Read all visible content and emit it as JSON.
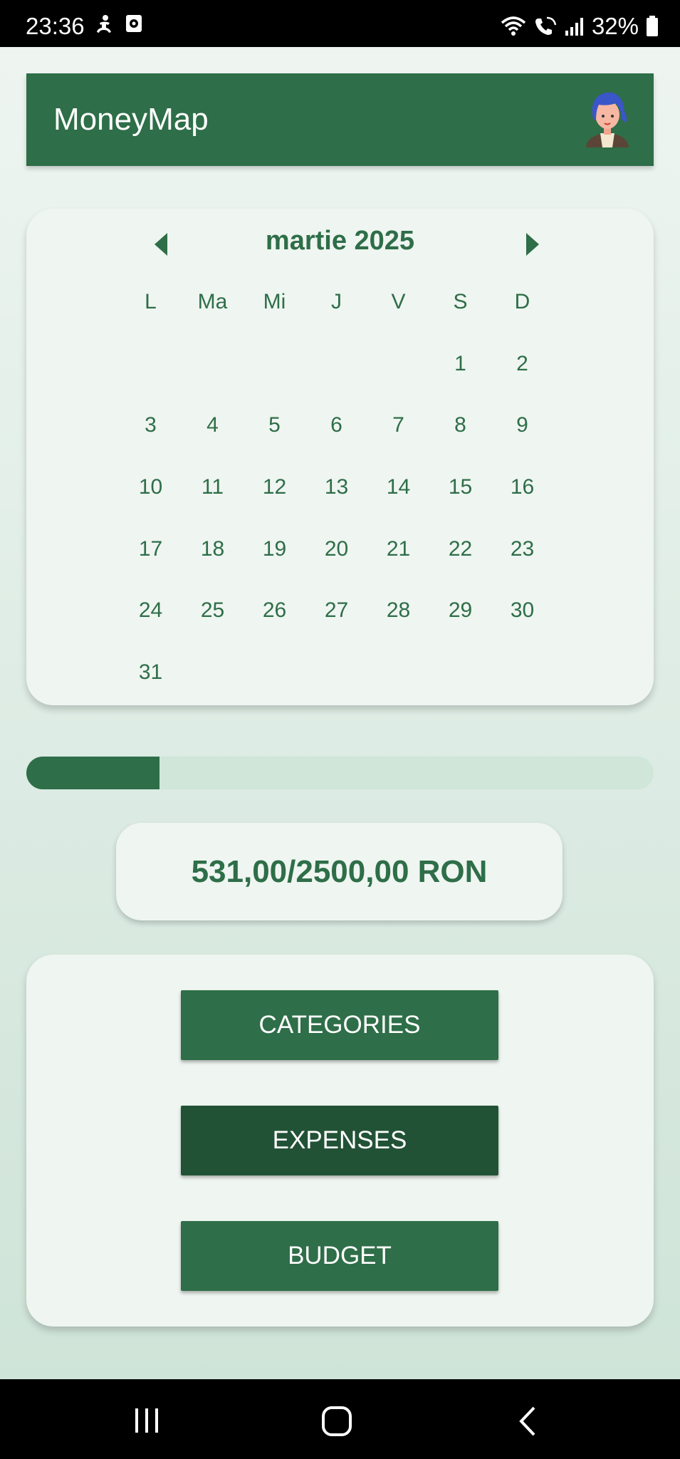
{
  "status_bar": {
    "time": "23:36",
    "battery_percent": "32%",
    "left_icons": [
      "accessibility-icon",
      "screenshot-icon"
    ],
    "right_icons": [
      "wifi-icon",
      "wifi-calling-icon",
      "signal-icon",
      "battery-icon"
    ]
  },
  "app_bar": {
    "title": "MoneyMap",
    "avatar_icon": "user-avatar"
  },
  "calendar": {
    "month_label": "martie 2025",
    "weekdays": [
      "L",
      "Ma",
      "Mi",
      "J",
      "V",
      "S",
      "D"
    ],
    "leading_blanks": 5,
    "days": [
      "1",
      "2",
      "3",
      "4",
      "5",
      "6",
      "7",
      "8",
      "9",
      "10",
      "11",
      "12",
      "13",
      "14",
      "15",
      "16",
      "17",
      "18",
      "19",
      "20",
      "21",
      "22",
      "23",
      "24",
      "25",
      "26",
      "27",
      "28",
      "29",
      "30",
      "31"
    ]
  },
  "budget": {
    "progress_fraction": 0.2124,
    "amount_text": "531,00/2500,00 RON"
  },
  "menu": {
    "categories_label": "CATEGORIES",
    "expenses_label": "EXPENSES",
    "budget_label": "BUDGET"
  },
  "colors": {
    "primary": "#2e6e48",
    "primary_dark": "#225236",
    "card": "#eff5f1",
    "progress_track": "#cfe6d9"
  }
}
